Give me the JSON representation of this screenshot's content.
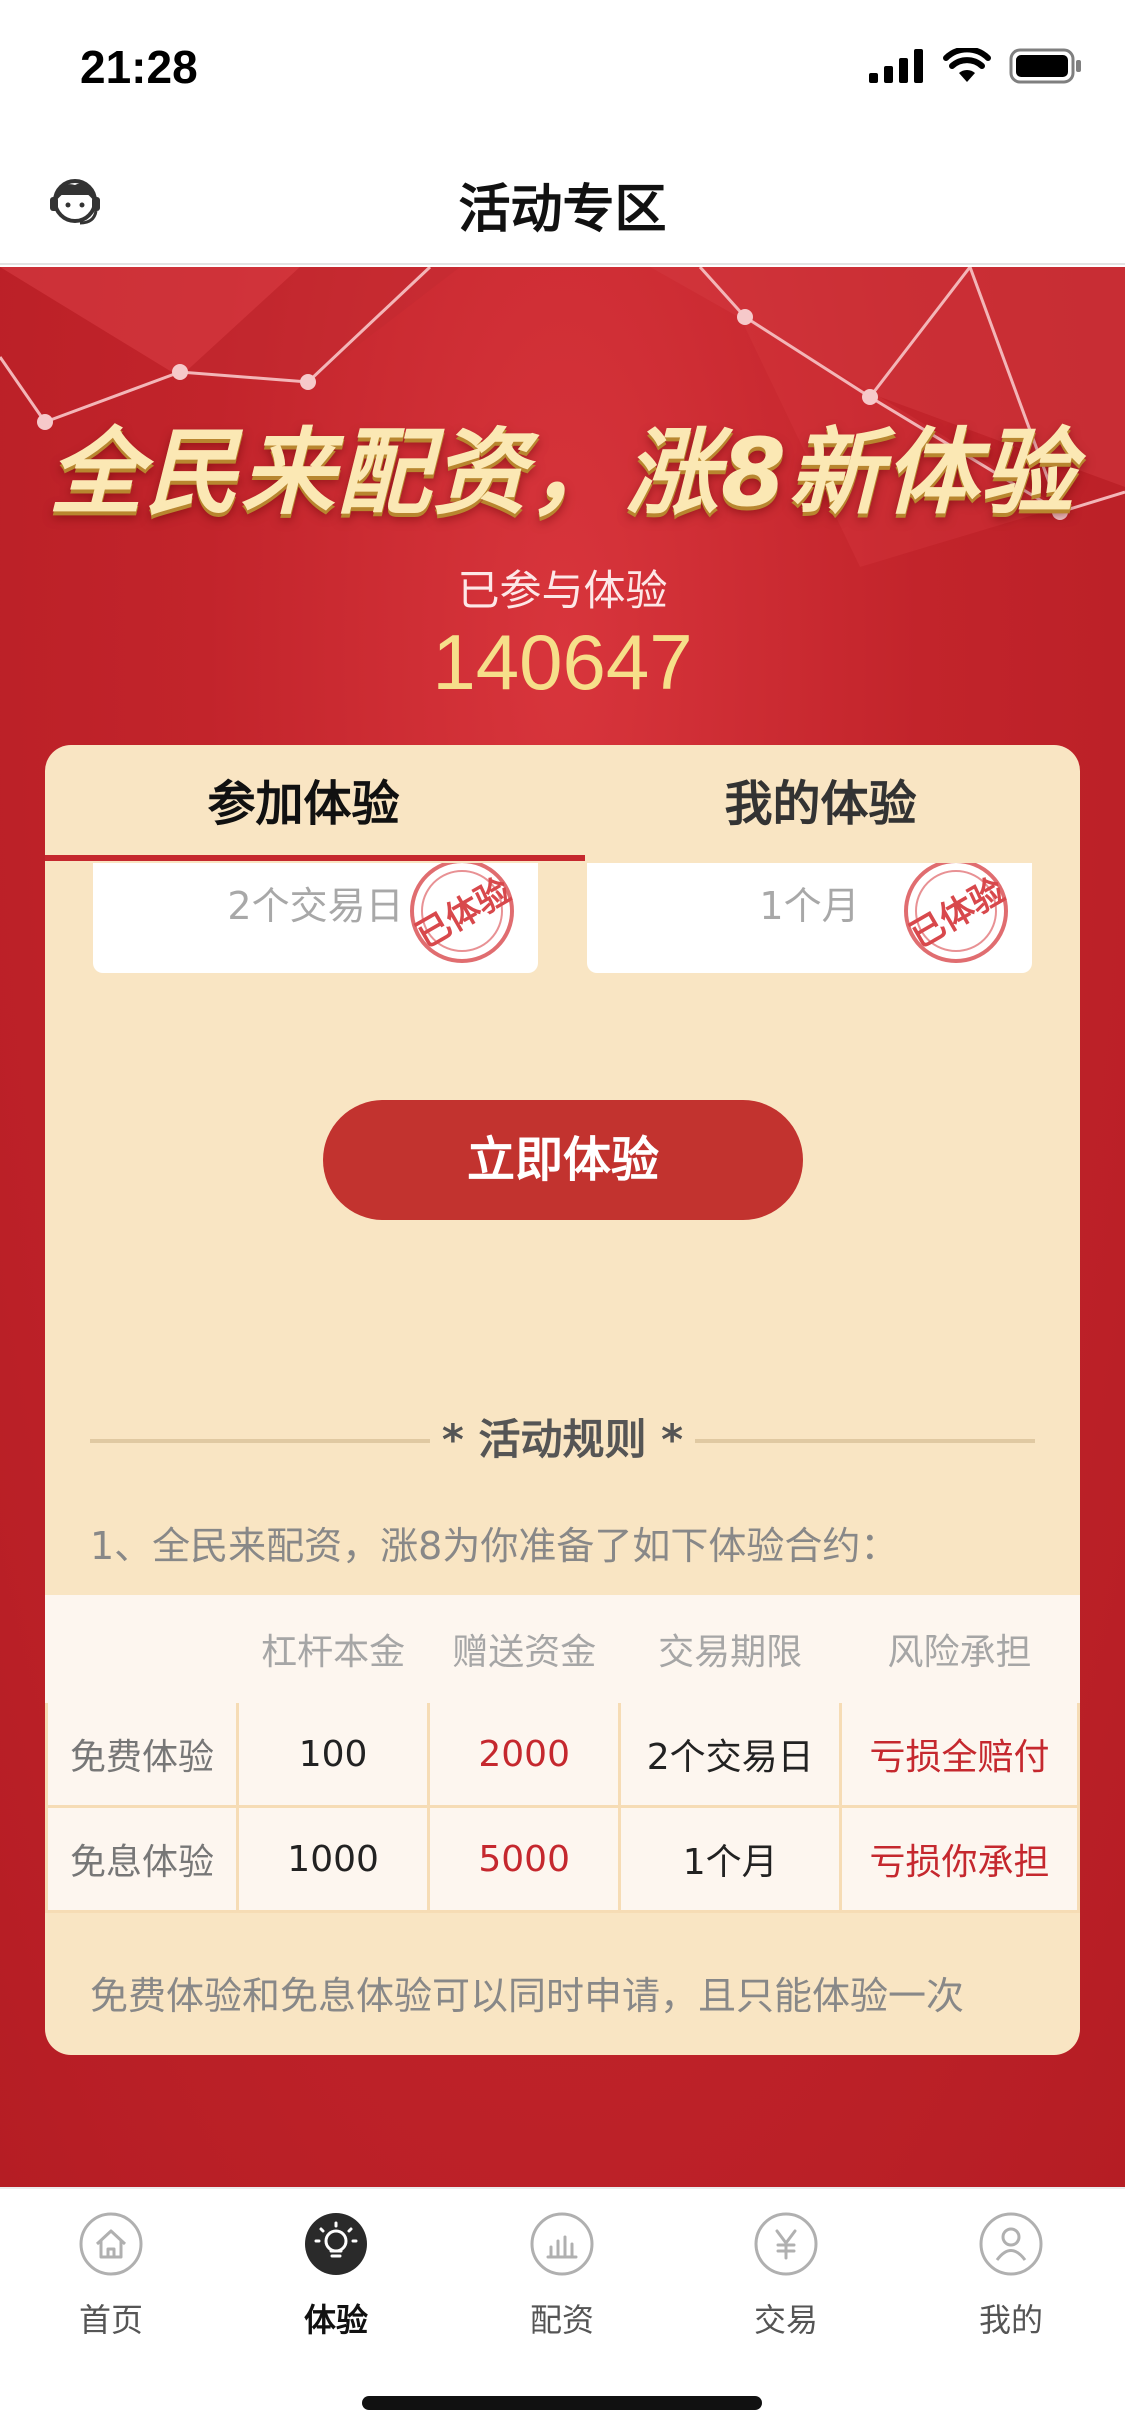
{
  "status_bar": {
    "time": "21:28"
  },
  "nav": {
    "title": "活动专区"
  },
  "hero": {
    "banner_title": "全民来配资，涨8新体验",
    "joined_label": "已参与体验",
    "joined_count": "140647"
  },
  "card": {
    "tabs": [
      {
        "label": "参加体验",
        "active": true
      },
      {
        "label": "我的体验",
        "active": false
      }
    ],
    "options": [
      {
        "text": "2个交易日",
        "stamp": "已体验"
      },
      {
        "text": "1个月",
        "stamp": "已体验"
      }
    ],
    "cta_label": "立即体验",
    "rules_title": "* 活动规则 *",
    "rules_desc": "1、全民来配资，涨8为你准备了如下体验合约：",
    "table": {
      "headers": [
        "",
        "杠杆本金",
        "赠送资金",
        "交易期限",
        "风险承担"
      ],
      "rows": [
        [
          "免费体验",
          "100",
          "2000",
          "2个交易日",
          "亏损全赔付"
        ],
        [
          "免息体验",
          "1000",
          "5000",
          "1个月",
          "亏损你承担"
        ]
      ]
    },
    "note": "免费体验和免息体验可以同时申请，且只能体验一次"
  },
  "tabbar": {
    "items": [
      {
        "label": "首页",
        "icon": "home-icon",
        "active": false
      },
      {
        "label": "体验",
        "icon": "bulb-icon",
        "active": true
      },
      {
        "label": "配资",
        "icon": "chart-icon",
        "active": false
      },
      {
        "label": "交易",
        "icon": "yen-icon",
        "active": false
      },
      {
        "label": "我的",
        "icon": "user-icon",
        "active": false
      }
    ]
  },
  "colors": {
    "brand_red": "#c5282e",
    "card_bg": "#f9e5c3",
    "count_gold": "#f6df8a"
  }
}
